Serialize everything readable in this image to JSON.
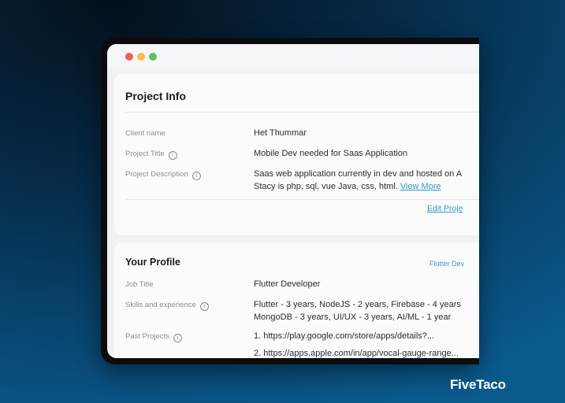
{
  "project_info": {
    "title": "Project Info",
    "client_label": "Client name",
    "client_value": "Het Thummar",
    "project_title_label": "Project Title",
    "project_title_value": "Mobile Dev needed for Saas Application",
    "description_label": "Project Description",
    "description_line1": "Saas web application currently in dev and hosted on A",
    "description_line2": "Stacy is php, sql, vue Java, css, html.",
    "view_more": "View More",
    "edit_link": "Edit Proje"
  },
  "profile": {
    "title": "Your Profile",
    "tag": "Flutter Dev",
    "job_label": "Job Title",
    "job_value": "Flutter Developer",
    "skills_label": "Skills and experience",
    "skills_line1": "Flutter - 3 years, NodeJS - 2 years, Firebase - 4 years",
    "skills_line2": "MongoDB - 3 years, UI/UX - 3 years, AI/ML - 1 year",
    "past_label": "Past Projects",
    "past_1": "1.  https://play.google.com/store/apps/details?...",
    "past_2": "2.  https://apps.apple.com/in/app/vocal-gauge-range..."
  },
  "icons": {
    "info": "i"
  },
  "brand": "FiveTaco"
}
